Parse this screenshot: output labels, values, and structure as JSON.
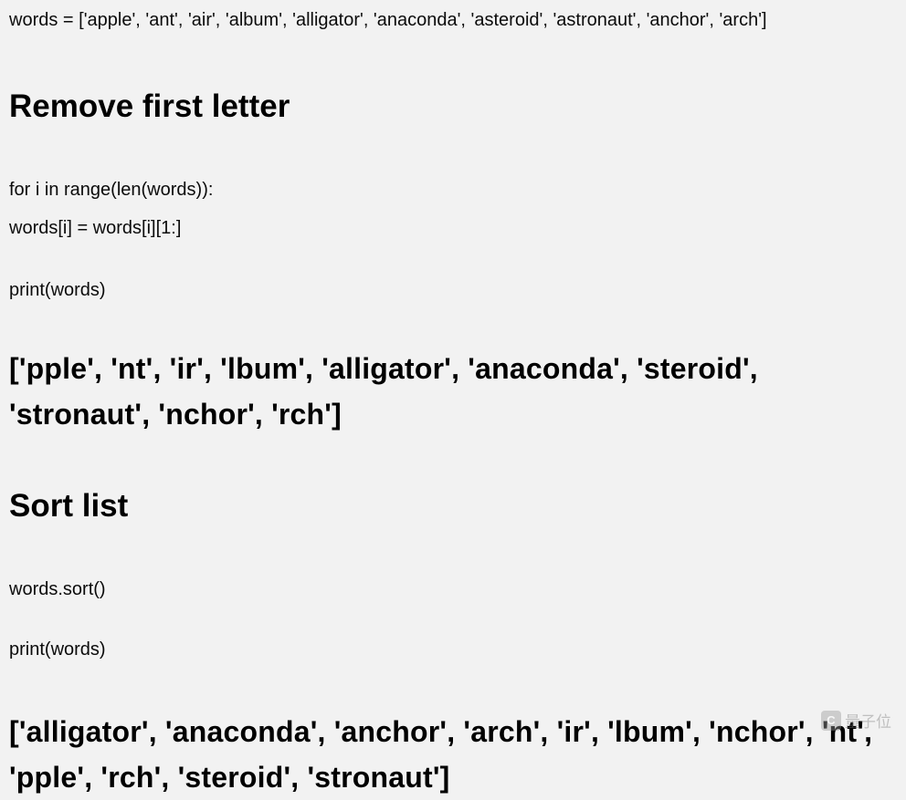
{
  "code_intro": "words = ['apple', 'ant', 'air', 'album', 'alligator', 'anaconda', 'asteroid', 'astronaut', 'anchor', 'arch']",
  "section1": {
    "heading": "Remove first letter",
    "code_line1": "for i in range(len(words)):",
    "code_line2": "words[i] = words[i][1:]",
    "code_print": "print(words)",
    "output": "['pple', 'nt', 'ir', 'lbum', 'alligator', 'anaconda', 'steroid', 'stronaut', 'nchor', 'rch']"
  },
  "section2": {
    "heading": "Sort list",
    "code_line1": "words.sort()",
    "code_print": "print(words)",
    "output": "['alligator', 'anaconda', 'anchor',  'arch', 'ir',  'lbum', 'nchor', 'nt', 'pple', 'rch', 'steroid', 'stronaut']"
  },
  "watermark": {
    "icon_label": "C",
    "text": "量子位"
  }
}
